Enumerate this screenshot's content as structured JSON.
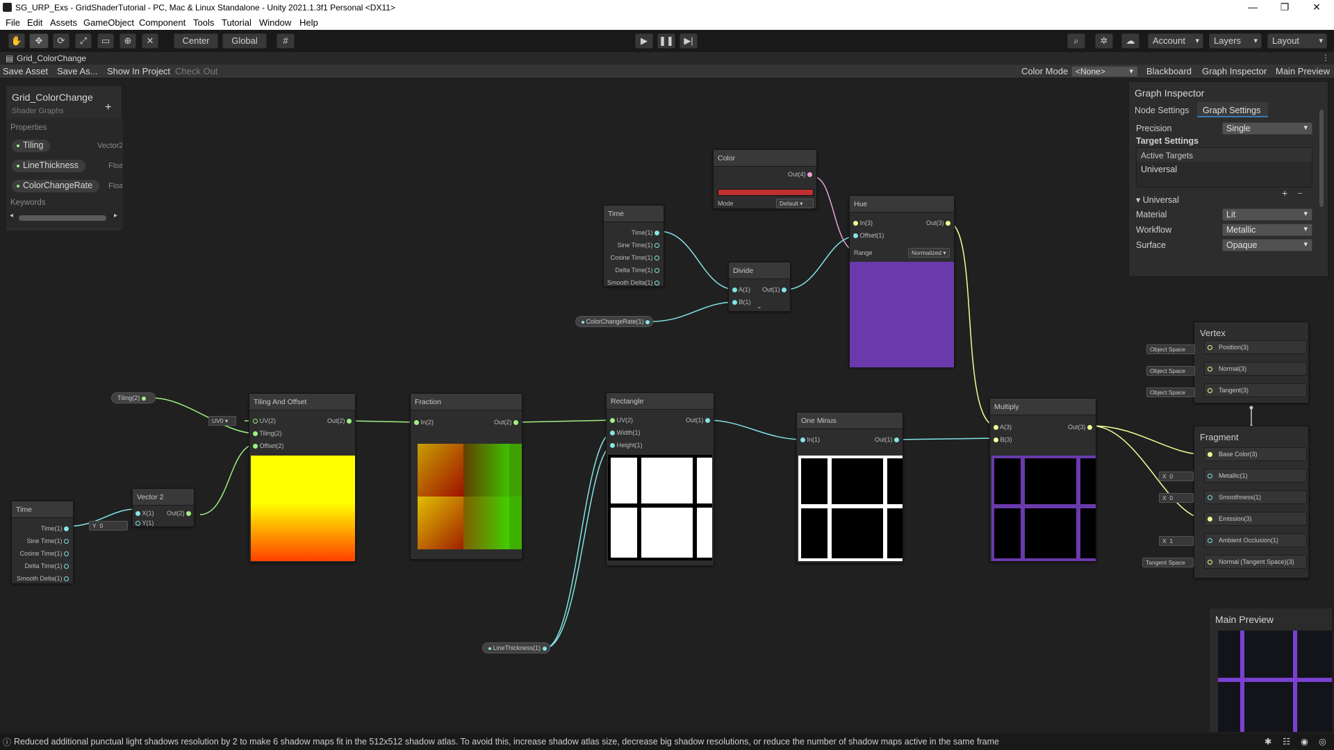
{
  "window": {
    "title": "SG_URP_Exs - GridShaderTutorial - PC, Mac & Linux Standalone - Unity 2021.1.3f1 Personal <DX11>"
  },
  "menu": [
    "File",
    "Edit",
    "Assets",
    "GameObject",
    "Component",
    "Tools",
    "Tutorial",
    "Window",
    "Help"
  ],
  "toolbar": {
    "pivot": "Center",
    "space": "Global",
    "account": "Account",
    "layers": "Layers",
    "layout": "Layout"
  },
  "tab": {
    "title": "Grid_ColorChange"
  },
  "sg_toolbar": {
    "save_asset": "Save Asset",
    "save_as": "Save As...",
    "show_in_project": "Show In Project",
    "check_out": "Check Out",
    "color_mode_label": "Color Mode",
    "color_mode_value": "<None>",
    "blackboard": "Blackboard",
    "graph_inspector": "Graph Inspector",
    "main_preview": "Main Preview"
  },
  "blackboard": {
    "title": "Grid_ColorChange",
    "subtitle": "Shader Graphs",
    "properties_label": "Properties",
    "keywords_label": "Keywords",
    "properties": [
      {
        "name": "Tiling",
        "type": "Vector2"
      },
      {
        "name": "LineThickness",
        "type": "Float"
      },
      {
        "name": "ColorChangeRate",
        "type": "Float"
      }
    ]
  },
  "inspector": {
    "title": "Graph Inspector",
    "tab_node": "Node Settings",
    "tab_graph": "Graph Settings",
    "precision_label": "Precision",
    "precision_value": "Single",
    "target_settings": "Target Settings",
    "active_targets": "Active Targets",
    "target": "Universal",
    "universal_section": "Universal",
    "material_label": "Material",
    "material_value": "Lit",
    "workflow_label": "Workflow",
    "workflow_value": "Metallic",
    "surface_label": "Surface",
    "surface_value": "Opaque"
  },
  "nodes": {
    "color": {
      "title": "Color",
      "out": "Out(4)",
      "mode_label": "Mode",
      "mode_value": "Default",
      "swatch": "#c03030"
    },
    "time_top": {
      "title": "Time",
      "ports": [
        "Time(1)",
        "Sine Time(1)",
        "Cosine Time(1)",
        "Delta Time(1)",
        "Smooth Delta(1)"
      ]
    },
    "divide": {
      "title": "Divide",
      "in_a": "A(1)",
      "in_b": "B(1)",
      "out": "Out(1)"
    },
    "hue": {
      "title": "Hue",
      "in": "In(3)",
      "offset": "Offset(1)",
      "out": "Out(3)",
      "range_label": "Range",
      "range_value": "Normalized"
    },
    "tiling_offset": {
      "title": "Tiling And Offset",
      "uv": "UV(2)",
      "tiling": "Tiling(2)",
      "offset": "Offset(2)",
      "out": "Out(2)",
      "uv_chip": "UV0"
    },
    "fraction": {
      "title": "Fraction",
      "in": "In(2)",
      "out": "Out(2)"
    },
    "rectangle": {
      "title": "Rectangle",
      "uv": "UV(2)",
      "width": "Width(1)",
      "height": "Height(1)",
      "out": "Out(1)"
    },
    "one_minus": {
      "title": "One Minus",
      "in": "In(1)",
      "out": "Out(1)"
    },
    "multiply": {
      "title": "Multiply",
      "a": "A(3)",
      "b": "B(3)",
      "out": "Out(3)"
    },
    "time_bottom": {
      "title": "Time",
      "ports": [
        "Time(1)",
        "Sine Time(1)",
        "Cosine Time(1)",
        "Delta Time(1)",
        "Smooth Delta(1)"
      ]
    },
    "vector2": {
      "title": "Vector 2",
      "x": "X(1)",
      "y": "Y(1)",
      "out": "Out(2)",
      "y_label": "Y",
      "y_value": "0"
    }
  },
  "prop_nodes": {
    "tiling": "Tiling(2)",
    "color_change_rate": "ColorChangeRate(1)",
    "line_thickness": "LineThickness(1)"
  },
  "master": {
    "vertex_title": "Vertex",
    "vertex_slots": [
      "Position(3)",
      "Normal(3)",
      "Tangent(3)"
    ],
    "vertex_space": "Object Space",
    "fragment_title": "Fragment",
    "fragment_slots": [
      "Base Color(3)",
      "Metallic(1)",
      "Smoothness(1)",
      "Emission(3)",
      "Ambient Occlusion(1)",
      "Normal (Tangent Space)(3)"
    ],
    "x_label": "X",
    "metallic_value": "0",
    "smoothness_value": "0",
    "ao_value": "1",
    "tangent_space": "Tangent Space"
  },
  "main_preview": {
    "title": "Main Preview"
  },
  "status": {
    "message": "Reduced additional punctual light shadows resolution by 2 to make 6 shadow maps fit in the 512x512 shadow atlas. To avoid this, increase shadow atlas size, decrease big shadow resolutions, or reduce the number of shadow maps active in the same frame"
  },
  "colors": {
    "accent_purple": "#6a3aac",
    "wire_vec1": "#84e4e7",
    "wire_vec2": "#9ef282",
    "wire_vec3": "#f1ff94",
    "wire_vec4": "#f0a0d8"
  }
}
